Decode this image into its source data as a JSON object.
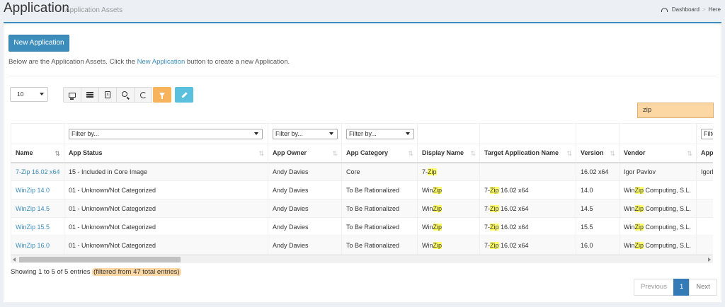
{
  "header": {
    "title": "Application",
    "subtitle": "Application Assets",
    "breadcrumb": [
      "Dashboard",
      "Here"
    ],
    "breadcrumb_separator": ">"
  },
  "actions": {
    "new_button": "New Application",
    "intro_before": "Below are the Application Assets. Click the ",
    "intro_link": "New Application",
    "intro_after": " button to create a new Application."
  },
  "controls": {
    "page_length": "10",
    "toolbar_icons": [
      "monitor-icon",
      "list-icon",
      "excel-file-icon",
      "zoom-icon",
      "refresh-icon",
      "filter-icon",
      "pencil-icon"
    ],
    "excel_glyph": "x",
    "search_value": "zip"
  },
  "table": {
    "filter_placeholder": "Filter by...",
    "filter_partial": "Filte",
    "columns": [
      "Name",
      "App Status",
      "App Owner",
      "App Category",
      "Display Name",
      "Target Application Name",
      "Version",
      "Vendor",
      "App I"
    ],
    "rows": [
      {
        "name": "7-Zip 16.02 x64",
        "status": "15 - Included in Core Image",
        "owner": "Andy Davies",
        "category": "Core",
        "display": [
          "7-",
          "Zip",
          ""
        ],
        "target": [
          "",
          "",
          ""
        ],
        "version": "16.02 x64",
        "vendor": [
          "Igor Pavlov",
          "",
          ""
        ],
        "app_id": "IgorP"
      },
      {
        "name": "WinZip 14.0",
        "status": "01 - Unknown/Not Categorized",
        "owner": "Andy Davies",
        "category": "To Be Rationalized",
        "display": [
          "Win",
          "Zip",
          ""
        ],
        "target": [
          "7-",
          "Zip",
          " 16.02 x64"
        ],
        "version": "14.0",
        "vendor": [
          "Win",
          "Zip",
          " Computing, S.L."
        ],
        "app_id": ""
      },
      {
        "name": "WinZip 14.5",
        "status": "01 - Unknown/Not Categorized",
        "owner": "Andy Davies",
        "category": "To Be Rationalized",
        "display": [
          "Win",
          "Zip",
          ""
        ],
        "target": [
          "7-",
          "Zip",
          " 16.02 x64"
        ],
        "version": "14.5",
        "vendor": [
          "Win",
          "Zip",
          " Computing, S.L."
        ],
        "app_id": ""
      },
      {
        "name": "WinZip 15.5",
        "status": "01 - Unknown/Not Categorized",
        "owner": "Andy Davies",
        "category": "To Be Rationalized",
        "display": [
          "Win",
          "Zip",
          ""
        ],
        "target": [
          "7-",
          "Zip",
          " 16.02 x64"
        ],
        "version": "15.5",
        "vendor": [
          "Win",
          "Zip",
          " Computing, S.L."
        ],
        "app_id": ""
      },
      {
        "name": "WinZip 16.0",
        "status": "01 - Unknown/Not Categorized",
        "owner": "Andy Davies",
        "category": "To Be Rationalized",
        "display": [
          "Win",
          "Zip",
          ""
        ],
        "target": [
          "7-",
          "Zip",
          " 16.02 x64"
        ],
        "version": "16.0",
        "vendor": [
          "Win",
          "Zip",
          " Computing, S.L."
        ],
        "app_id": ""
      }
    ]
  },
  "footer": {
    "info": "Showing 1 to 5 of 5 entries",
    "filtered": "(filtered from 47 total entries)",
    "pagination": {
      "previous": "Previous",
      "current": "1",
      "next": "Next"
    }
  },
  "colors": {
    "primary": "#3c8dbc",
    "highlight": "#ffff66",
    "search_bg": "#fcd7a4",
    "warning_btn": "#f8b45c",
    "info_btn": "#5bc0de"
  }
}
